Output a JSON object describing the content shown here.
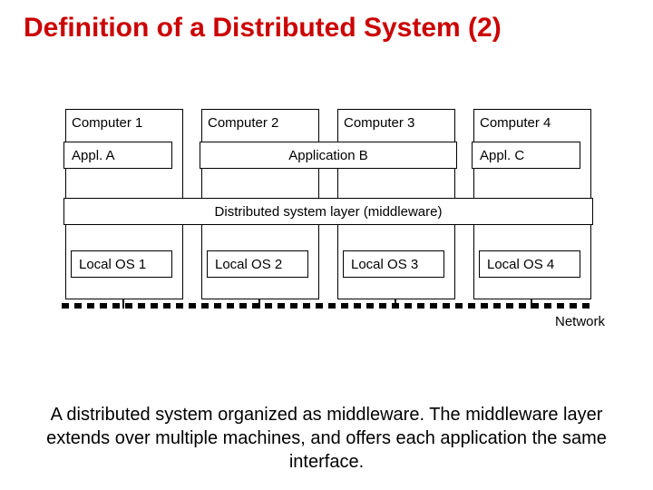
{
  "title": "Definition of a Distributed System (2)",
  "cols": {
    "c1": "Computer 1",
    "c2": "Computer 2",
    "c3": "Computer 3",
    "c4": "Computer 4"
  },
  "apps": {
    "a": "Appl. A",
    "b": "Application B",
    "c": "Appl. C"
  },
  "middleware": "Distributed system layer (middleware)",
  "os": {
    "o1": "Local OS 1",
    "o2": "Local OS 2",
    "o3": "Local OS 3",
    "o4": "Local OS 4"
  },
  "network_label": "Network",
  "caption": "A distributed system organized as middleware. The middleware layer extends over multiple machines, and offers each application the same interface."
}
